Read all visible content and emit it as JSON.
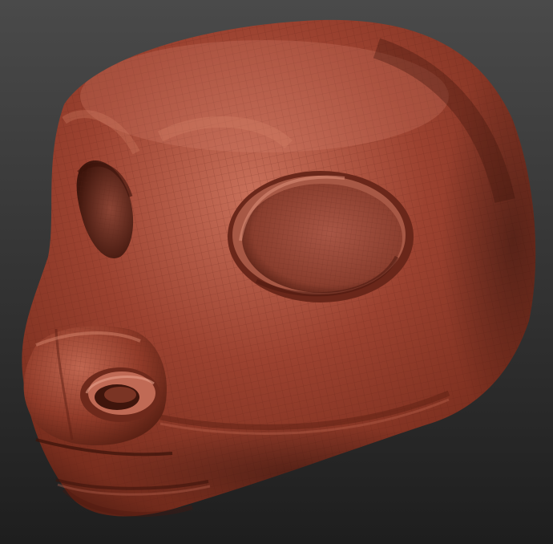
{
  "scene": {
    "subject": "sculpted-head-model",
    "background_top": "#4a4a4a",
    "background_bottom": "#1e1e1e",
    "material_base": "#8a3826",
    "material_light": "#c8705a",
    "material_mid": "#9c4230",
    "material_dark": "#4a1a10",
    "wireframe": "#5a2016"
  }
}
